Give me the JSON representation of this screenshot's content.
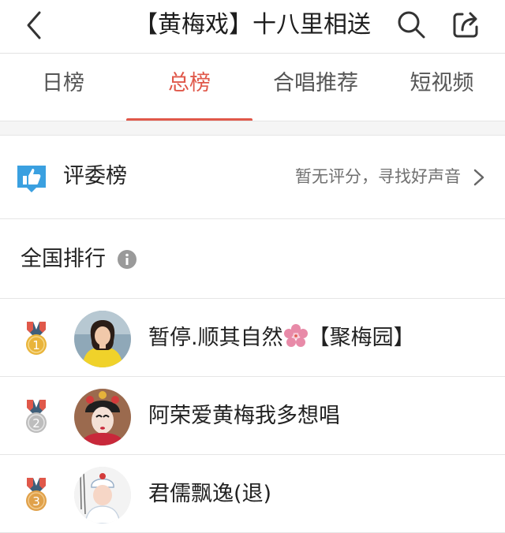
{
  "header": {
    "title": "【黄梅戏】十八里相送",
    "back_icon": "chevron-left-icon",
    "search_icon": "search-icon",
    "share_icon": "share-icon"
  },
  "tabs": [
    {
      "label": "日榜",
      "active": false
    },
    {
      "label": "总榜",
      "active": true
    },
    {
      "label": "合唱推荐",
      "active": false
    },
    {
      "label": "短视频",
      "active": false
    }
  ],
  "judges": {
    "label": "评委榜",
    "hint": "暂无评分，寻找好声音",
    "icon": "thumbs-up-icon"
  },
  "ranking": {
    "title": "全国排行",
    "info_icon": "info-icon",
    "items": [
      {
        "rank": "1",
        "name_before": "暂停.顺其自然",
        "emoji": "flower",
        "name_after": "【聚梅园】",
        "medal": "gold"
      },
      {
        "rank": "2",
        "name_before": "阿荣爱黄梅我多想唱",
        "emoji": "",
        "name_after": "",
        "medal": "silver"
      },
      {
        "rank": "3",
        "name_before": "君儒飘逸(退)",
        "emoji": "",
        "name_after": "",
        "medal": "bronze"
      }
    ]
  },
  "colors": {
    "accent": "#e0584a",
    "thumb_blue": "#3aa0e0",
    "gold": "#e9b43a",
    "silver": "#bdbdbd",
    "bronze": "#e0a14a"
  }
}
